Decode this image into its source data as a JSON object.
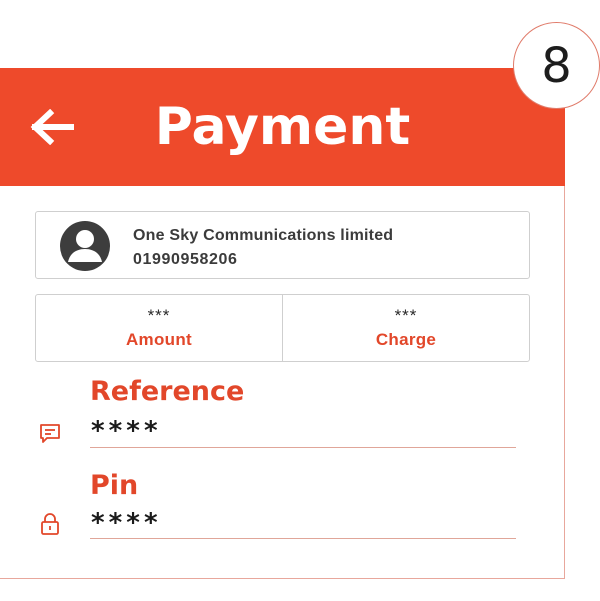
{
  "header": {
    "title": "Payment",
    "back_icon": "arrow-left-icon",
    "background_color": "#ee4a2b"
  },
  "step_badge": {
    "number": "8"
  },
  "recipient": {
    "name": "One Sky Communications limited",
    "phone": "01990958206",
    "avatar_icon": "user-avatar-icon"
  },
  "summary": {
    "amount": {
      "value": "***",
      "label": "Amount"
    },
    "charge": {
      "value": "***",
      "label": "Charge"
    }
  },
  "fields": {
    "reference": {
      "label": "Reference",
      "value": "****",
      "icon": "message-icon"
    },
    "pin": {
      "label": "Pin",
      "value": "****",
      "icon": "lock-icon"
    }
  },
  "colors": {
    "accent": "#e2472a",
    "text": "#3b3b3b",
    "border": "#cfcfcf"
  }
}
